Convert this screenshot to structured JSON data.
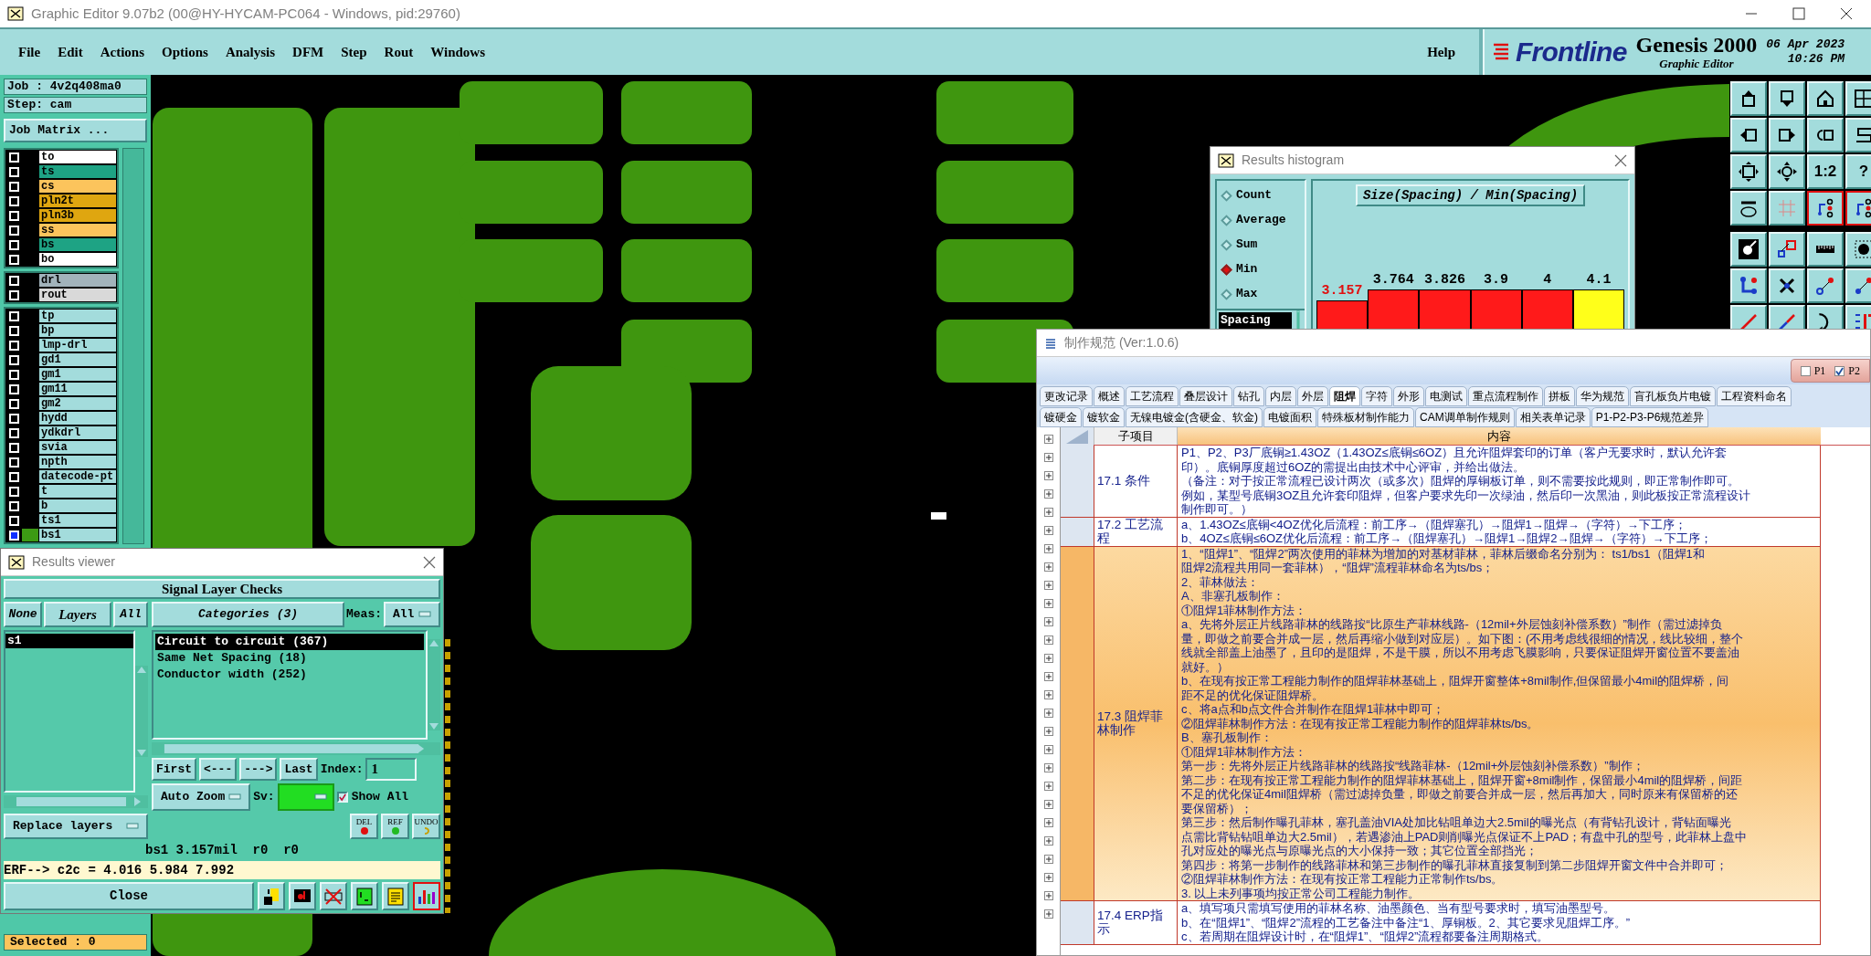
{
  "window": {
    "title": "Graphic Editor 9.07b2 (00@HY-HYCAM-PC064 - Windows, pid:29760)"
  },
  "menu": [
    "File",
    "Edit",
    "Actions",
    "Options",
    "Analysis",
    "DFM",
    "Step",
    "Rout",
    "Windows"
  ],
  "help": "Help",
  "brand": {
    "logo": "Frontline",
    "product": "Genesis 2000",
    "subtitle": "Graphic Editor",
    "date": "06 Apr 2023",
    "time": "10:26 PM"
  },
  "job_panel": {
    "job": "Job : 4v2q408ma0",
    "step": "Step: cam",
    "matrix_button": "Job Matrix ...",
    "layer_groups": [
      [
        {
          "name": "to",
          "color": "#ffffff",
          "affected": false,
          "selected": false
        },
        {
          "name": "ts",
          "color": "#1ea384",
          "affected": false,
          "selected": false
        },
        {
          "name": "cs",
          "color": "#fcc45c",
          "affected": false,
          "selected": false
        },
        {
          "name": "pln2t",
          "color": "#dfa610",
          "affected": false,
          "selected": false
        },
        {
          "name": "pln3b",
          "color": "#dfa610",
          "affected": false,
          "selected": false
        },
        {
          "name": "ss",
          "color": "#fcc45c",
          "affected": false,
          "selected": false
        },
        {
          "name": "bs",
          "color": "#1ea384",
          "affected": false,
          "selected": false
        },
        {
          "name": "bo",
          "color": "#ffffff",
          "affected": false,
          "selected": false
        }
      ],
      [
        {
          "name": "drl",
          "color": "#a2b3bb",
          "affected": false,
          "selected": false
        },
        {
          "name": "rout",
          "color": "#d9d9d9",
          "affected": false,
          "selected": false
        }
      ],
      [
        {
          "name": "tp",
          "color": "#a3dcdc",
          "affected": false,
          "selected": false
        },
        {
          "name": "bp",
          "color": "#a3dcdc",
          "affected": false,
          "selected": false
        },
        {
          "name": "lmp-drl",
          "color": "#a3dcdc",
          "affected": false,
          "selected": false
        },
        {
          "name": "gd1",
          "color": "#a3dcdc",
          "affected": false,
          "selected": false
        },
        {
          "name": "gm1",
          "color": "#a3dcdc",
          "affected": false,
          "selected": false
        },
        {
          "name": "gm11",
          "color": "#a3dcdc",
          "affected": false,
          "selected": false
        },
        {
          "name": "gm2",
          "color": "#a3dcdc",
          "affected": false,
          "selected": false
        },
        {
          "name": "hydd",
          "color": "#a3dcdc",
          "affected": false,
          "selected": false
        },
        {
          "name": "ydkdrl",
          "color": "#a3dcdc",
          "affected": false,
          "selected": false
        },
        {
          "name": "svia",
          "color": "#a3dcdc",
          "affected": false,
          "selected": false
        },
        {
          "name": "npth",
          "color": "#a3dcdc",
          "affected": false,
          "selected": false
        },
        {
          "name": "datecode-pt",
          "color": "#a3dcdc",
          "affected": false,
          "selected": false
        },
        {
          "name": "t",
          "color": "#a3dcdc",
          "affected": false,
          "selected": false
        },
        {
          "name": "b",
          "color": "#a3dcdc",
          "affected": false,
          "selected": false
        },
        {
          "name": "ts1",
          "color": "#a3dcdc",
          "affected": false,
          "selected": false
        },
        {
          "name": "bs1",
          "color": "#a3dcdc",
          "affected": true,
          "selected": true
        }
      ]
    ],
    "selection_count": "Selected : 0"
  },
  "tool_groups": [
    [
      {
        "kind": "up",
        "selected": false
      },
      {
        "kind": "down",
        "selected": false
      },
      {
        "kind": "home",
        "selected": false
      },
      {
        "kind": "window",
        "selected": false
      },
      {
        "kind": "left",
        "selected": false
      },
      {
        "kind": "right",
        "selected": false
      },
      {
        "kind": "undo",
        "selected": false
      },
      {
        "kind": "curve",
        "selected": false
      },
      {
        "kind": "fit",
        "selected": false
      },
      {
        "kind": "move",
        "selected": false
      },
      {
        "kind": "text",
        "label": "1:2",
        "selected": false
      },
      {
        "kind": "text",
        "label": "?",
        "selected": false
      },
      {
        "kind": "palette",
        "selected": false
      },
      {
        "kind": "grid",
        "selected": false
      },
      {
        "kind": "circuit",
        "selected": true
      },
      {
        "kind": "circuit",
        "selected": true
      }
    ],
    [
      {
        "kind": "target",
        "selected": false
      },
      {
        "kind": "rectangles",
        "selected": false
      },
      {
        "kind": "ruler",
        "selected": false
      },
      {
        "kind": "dotted",
        "selected": false
      },
      {
        "kind": "nodes",
        "selected": false
      },
      {
        "kind": "cross",
        "selected": false
      },
      {
        "kind": "connect",
        "selected": false
      },
      {
        "kind": "connect-filled",
        "selected": false
      },
      {
        "kind": "slash",
        "selected": false
      },
      {
        "kind": "slash-two",
        "selected": false
      },
      {
        "kind": "redo",
        "selected": false
      },
      {
        "kind": "bars",
        "selected": false
      }
    ]
  ],
  "histogram": {
    "title": "Results histogram",
    "modes": [
      {
        "label": "Count",
        "selected": false
      },
      {
        "label": "Average",
        "selected": false
      },
      {
        "label": "Sum",
        "selected": false
      },
      {
        "label": "Min",
        "selected": true
      },
      {
        "label": "Max",
        "selected": false
      }
    ],
    "fields": [
      {
        "label": "Spacing",
        "selected": true
      }
    ],
    "chart_title": "Size(Spacing) / Min(Spacing)",
    "bins": [
      {
        "label": "3.157",
        "color": "#ff1a1a",
        "selected": true
      },
      {
        "label": "3.764",
        "color": "#ff1a1a",
        "selected": false
      },
      {
        "label": "3.826",
        "color": "#ff1a1a",
        "selected": false
      },
      {
        "label": "3.9",
        "color": "#ff1a1a",
        "selected": false
      },
      {
        "label": "4",
        "color": "#ff1a1a",
        "selected": false
      },
      {
        "label": "4.1",
        "color": "#ffff1a",
        "selected": false
      }
    ]
  },
  "results_viewer": {
    "title": "Results viewer",
    "header": "Signal Layer Checks",
    "layer_buttons": [
      "None",
      "All"
    ],
    "layers_title": "Layers",
    "layers": [
      {
        "name": "s1",
        "selected": true
      }
    ],
    "categories_button": "Categories (3)",
    "meas_label": "Meas:",
    "meas_value": "All",
    "categories": [
      {
        "label": "Circuit to circuit (367)",
        "selected": true
      },
      {
        "label": "Same Net Spacing (18)",
        "selected": false
      },
      {
        "label": "Conductor width (252)",
        "selected": false
      }
    ],
    "nav_buttons": [
      "First",
      "<---",
      "--->",
      "Last"
    ],
    "index_label": "Index:",
    "index_value": "1",
    "zoom_mode": "Auto Zoom",
    "sv_label": "Sv:",
    "show_all": {
      "label": "Show All",
      "checked": true
    },
    "replace_mode": "Replace layers",
    "edit_buttons": [
      {
        "kind": "delete",
        "label": "DEL"
      },
      {
        "kind": "reference",
        "label": "REF"
      },
      {
        "kind": "undo",
        "label": "UNDO"
      }
    ],
    "status": "bs1 3.157mil  r0  r0",
    "reference_line": "ERF--> c2c = 4.016 5.984 7.992",
    "close_button": "Close",
    "tool_buttons": [
      {
        "kind": "figure",
        "selected": false
      },
      {
        "kind": "monitor",
        "selected": false
      },
      {
        "kind": "crossed",
        "selected": false
      },
      {
        "kind": "page",
        "selected": false
      },
      {
        "kind": "notes",
        "selected": false
      },
      {
        "kind": "chart",
        "selected": true
      }
    ]
  },
  "spec_dialog": {
    "title": "制作规范 (Ver:1.0.6)",
    "plants": [
      {
        "label": "P1",
        "checked": false
      },
      {
        "label": "P2",
        "checked": true
      }
    ],
    "tab_rows": [
      [
        {
          "label": "更改记录",
          "selected": false
        },
        {
          "label": "概述",
          "selected": false
        },
        {
          "label": "工艺流程",
          "selected": false
        },
        {
          "label": "叠层设计",
          "selected": false
        },
        {
          "label": "钻孔",
          "selected": false
        },
        {
          "label": "内层",
          "selected": false
        },
        {
          "label": "外层",
          "selected": false
        },
        {
          "label": "阻焊",
          "selected": true
        },
        {
          "label": "字符",
          "selected": false
        },
        {
          "label": "外形",
          "selected": false
        },
        {
          "label": "电测试",
          "selected": false
        },
        {
          "label": "重点流程制作",
          "selected": false
        },
        {
          "label": "拼板",
          "selected": false
        },
        {
          "label": "华为规范",
          "selected": false
        },
        {
          "label": "盲孔板负片电镀",
          "selected": false
        },
        {
          "label": "工程资料命名",
          "selected": false
        }
      ],
      [
        {
          "label": "镀硬金",
          "selected": false
        },
        {
          "label": "镀软金",
          "selected": false
        },
        {
          "label": "无镍电镀金(含硬金、软金)",
          "selected": false
        },
        {
          "label": "电镀面积",
          "selected": false
        },
        {
          "label": "特殊板材制作能力",
          "selected": false
        },
        {
          "label": "CAM调单制作规则",
          "selected": false
        },
        {
          "label": "相关表单记录",
          "selected": false
        },
        {
          "label": "P1-P2-P3-P6规范差异",
          "selected": false
        }
      ]
    ],
    "columns": [
      "子项目",
      "内容"
    ],
    "rows": [
      {
        "label": "17.1 条件",
        "selected": false,
        "lines": [
          "P1、P2、P3厂底铜≥1.43OZ（1.43OZ≤底铜≤6OZ）且允许阻焊套印的订单（客户无要求时，默认允许套",
          "印）。底铜厚度超过6OZ的需提出由技术中心评审，并给出做法。",
          "（备注：对于按正常流程已设计两次（或多次）阻焊的厚铜板订单，则不需要按此规则，即正常制作即可。",
          "例如，某型号底铜3OZ且允许套印阻焊，但客户要求先印一次绿油，然后印一次黑油，则此板按正常流程设计",
          "制作即可。）"
        ]
      },
      {
        "label": "17.2 工艺流程",
        "selected": false,
        "lines": [
          "a、1.43OZ≤底铜<4OZ优化后流程：前工序→（阻焊塞孔）→阻焊1→阻焊→（字符）→下工序；",
          "b、4OZ≤底铜≤6OZ优化后流程：前工序→（阻焊塞孔）→阻焊1→阻焊2→阻焊→（字符）→下工序；"
        ]
      },
      {
        "label": "17.3 阻焊菲林制作",
        "selected": true,
        "lines": [
          "1、“阻焊1”、“阻焊2”两次使用的菲林为增加的对基材菲林，菲林后缀命名分别为： ts1/bs1（阻焊1和",
          "阻焊2流程共用同一套菲林），“阻焊”流程菲林命名为ts/bs；",
          "2、菲林做法：",
          "A、非塞孔板制作：",
          "①阻焊1菲林制作方法：",
          "a、先将外层正片线路菲林的线路按“比原生产菲林线路-（12mil+外层蚀刻补偿系数）”制作（需过滤掉负",
          "量，即做之前要合并成一层，然后再缩小做到对应层）。如下图：(不用考虑线很细的情况，线比较细，整个",
          "线就全部盖上油墨了，且印的是阻焊，不是干膜，所以不用考虑飞膜影响，只要保证阻焊开窗位置不要盖油",
          "就好。）",
          "b、在现有按正常工程能力制作的阻焊菲林基础上，阻焊开窗整体+8mil制作,但保留最小4mil的阻焊桥，间",
          "距不足的优化保证阻焊桥。",
          "c、将a点和b点文件合并制作在阻焊1菲林中即可；",
          "②阻焊菲林制作方法：在现有按正常工程能力制作的阻焊菲林ts/bs。",
          "B、塞孔板制作：",
          "①阻焊1菲林制作方法：",
          "第一步：先将外层正片线路菲林的线路按“线路菲林-（12mil+外层蚀刻补偿系数）”制作；",
          "第二步：在现有按正常工程能力制作的阻焊菲林基础上，阻焊开窗+8mil制作，保留最小4mil的阻焊桥，间距",
          "不足的优化保证4mil阻焊桥（需过滤掉负量，即做之前要合并成一层，然后再加大，同时原来有保留桥的还",
          "要保留桥）；",
          "第三步：然后制作曝孔菲林，塞孔盖油VIA处加比钻咀单边大2.5mil的曝光点（有背钻孔设计，背钻面曝光",
          "点需比背钻钻咀单边大2.5mil），若遇渗油上PAD则削曝光点保证不上PAD；有盘中孔的型号，此菲林上盘中",
          "孔对应处的曝光点与原曝光点的大小保持一致；其它位置全部挡光；",
          "第四步：将第一步制作的线路菲林和第三步制作的曝孔菲林直接复制到第二步阻焊开窗文件中合并即可；",
          "②阻焊菲林制作方法：在现有按正常工程能力正常制作ts/bs。",
          "3. 以上未列事项均按正常公司工程能力制作。"
        ]
      },
      {
        "label": "17.4 ERP指示",
        "selected": false,
        "lines": [
          "a、填写项只需填写使用的菲林名称、油墨颜色、当有型号要求时，填写油墨型号。",
          "b、在“阻焊1”、“阻焊2”流程的工艺备注中备注“1、厚铜板。2、其它要求见阻焊工序。”",
          "c、若周期在阻焊设计时，在“阻焊1”、“阻焊2”流程都要备注周期格式。"
        ]
      }
    ]
  }
}
